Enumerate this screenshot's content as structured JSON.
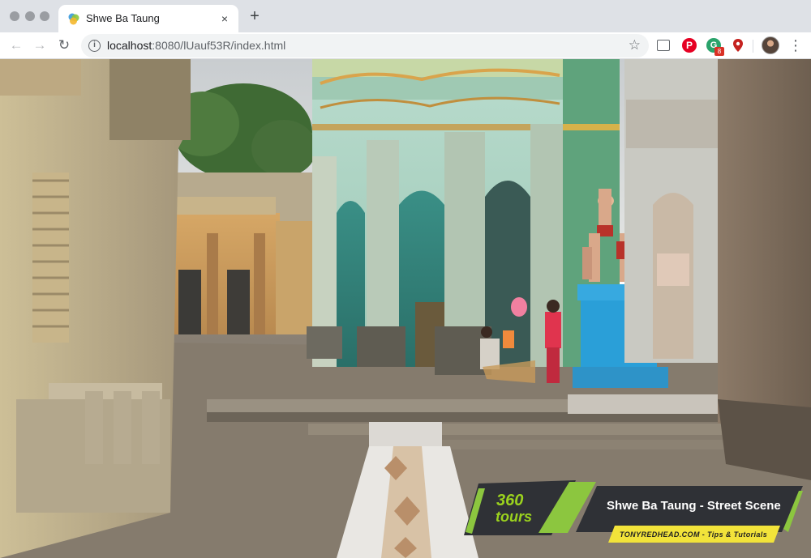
{
  "browser": {
    "tab_title": "Shwe Ba Taung",
    "tab_close": "×",
    "new_tab": "+",
    "url_host": "localhost",
    "url_rest": ":8080/lUauf53R/index.html",
    "star": "☆",
    "extensions": {
      "pinterest_letter": "P",
      "grammarly_letter": "G",
      "grammarly_badge": "8"
    },
    "menu": "⋮"
  },
  "nav": {
    "back": "←",
    "forward": "→",
    "reload": "↻",
    "info": "i"
  },
  "overlay": {
    "logo_360": "360",
    "logo_tours": "tours",
    "title": "Shwe Ba Taung - Street Scene",
    "subtitle": "TONYREDHEAD.COM - Tips & Tutorials",
    "accent_green": "#8cc63f",
    "panel_dark": "#2f3136",
    "subtitle_bg": "#f2e33a"
  },
  "colors": {
    "tabbar_bg": "#dee1e6",
    "omnibox_bg": "#f1f3f4",
    "temple_mint": "#a9d6c6",
    "plinth_blue": "#2a9fd8"
  }
}
